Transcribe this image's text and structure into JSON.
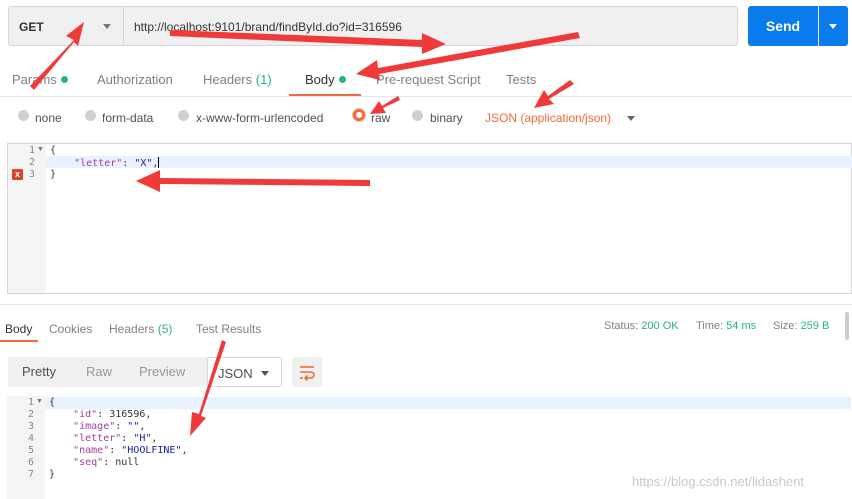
{
  "request": {
    "method": "GET",
    "url": "http://localhost:9101/brand/findById.do?id=316596",
    "send_label": "Send"
  },
  "tabs": {
    "params": "Params",
    "authorization": "Authorization",
    "headers": "Headers",
    "headers_count": "(1)",
    "body": "Body",
    "prerequest": "Pre-request Script",
    "tests": "Tests"
  },
  "body_modes": {
    "none": "none",
    "form_data": "form-data",
    "urlencoded": "x-www-form-urlencoded",
    "raw": "raw",
    "binary": "binary",
    "content_type": "JSON (application/json)"
  },
  "request_editor": {
    "lines": [
      {
        "num": "1",
        "text": "{"
      },
      {
        "num": "2",
        "key": "\"letter\"",
        "sep": ": ",
        "val": "\"X\"",
        "tail": ","
      },
      {
        "num": "3",
        "text": "}"
      }
    ],
    "error_marker": "x"
  },
  "response_tabs": {
    "body": "Body",
    "cookies": "Cookies",
    "headers": "Headers",
    "headers_count": "(5)",
    "test_results": "Test Results"
  },
  "status": {
    "status_label": "Status:",
    "status_value": "200 OK",
    "time_label": "Time:",
    "time_value": "54 ms",
    "size_label": "Size:",
    "size_value": "259 B"
  },
  "format": {
    "pretty": "Pretty",
    "raw": "Raw",
    "preview": "Preview",
    "type": "JSON"
  },
  "response_editor": {
    "lines": [
      {
        "num": "1",
        "text": "{"
      },
      {
        "num": "2",
        "key": "\"id\"",
        "val": "316596",
        "tail": ","
      },
      {
        "num": "3",
        "key": "\"image\"",
        "val": "\"\"",
        "tail": ","
      },
      {
        "num": "4",
        "key": "\"letter\"",
        "val": "\"H\"",
        "tail": ","
      },
      {
        "num": "5",
        "key": "\"name\"",
        "val": "\"HOOLFINE\"",
        "tail": ","
      },
      {
        "num": "6",
        "key": "\"seq\"",
        "val": "null",
        "tail": ""
      },
      {
        "num": "7",
        "text": "}"
      }
    ]
  },
  "watermark": "https://blog.csdn.net/lidashent",
  "colors": {
    "accent": "#f26b3a",
    "send": "#097bed",
    "success": "#26b47f",
    "annotation_arrow": "#f03a3a"
  }
}
